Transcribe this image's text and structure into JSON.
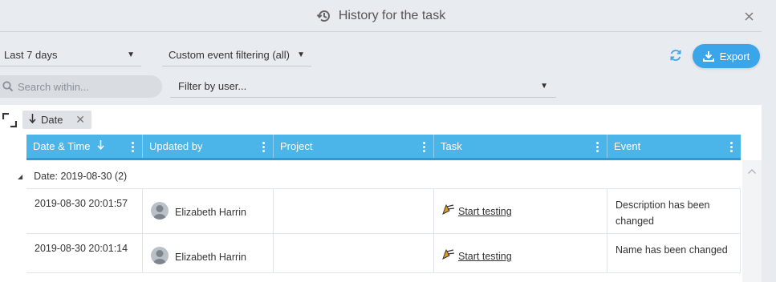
{
  "header": {
    "title": "History for the task",
    "history_icon": "history-icon",
    "close_icon": "close-icon"
  },
  "toolbar": {
    "period_value": "Last 7 days",
    "event_filter_value": "Custom event filtering (all)",
    "refresh_icon": "refresh-icon",
    "export_label": "Export",
    "search_placeholder": "Search within...",
    "user_filter_placeholder": "Filter by user..."
  },
  "grouping": {
    "chip_label": "Date",
    "chip_direction": "descending"
  },
  "table": {
    "columns": [
      "Date & Time",
      "Updated by",
      "Project",
      "Task",
      "Event"
    ],
    "sorted_column": "Date & Time",
    "group_label": "Date: 2019-08-30 (2)",
    "rows": [
      {
        "datetime": "2019-08-30 20:01:57",
        "user": "Elizabeth Harrin",
        "project": "",
        "task": "Start testing",
        "event": "Description has been changed"
      },
      {
        "datetime": "2019-08-30 20:01:14",
        "user": "Elizabeth Harrin",
        "project": "",
        "task": "Start testing",
        "event": "Name has been changed"
      }
    ]
  },
  "colors": {
    "accent": "#3ba5ea",
    "header_bg": "#4bb5ea",
    "background": "#e8ebef"
  }
}
